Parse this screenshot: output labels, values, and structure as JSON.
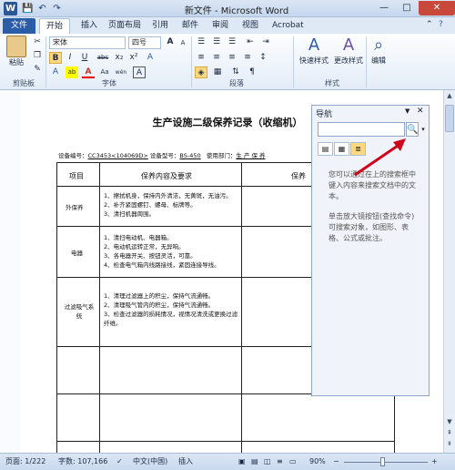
{
  "window": {
    "title": "新文件 - Microsoft Word",
    "minimize": "—",
    "maximize": "□",
    "close": "✕"
  },
  "quick_access": {
    "save": "💾",
    "undo": "↶",
    "redo": "↷"
  },
  "tabs": [
    {
      "label": "文件"
    },
    {
      "label": "开始"
    },
    {
      "label": "插入"
    },
    {
      "label": "页面布局"
    },
    {
      "label": "引用"
    },
    {
      "label": "邮件"
    },
    {
      "label": "审阅"
    },
    {
      "label": "视图"
    },
    {
      "label": "Acrobat"
    }
  ],
  "ribbon": {
    "clipboard": {
      "paste": "粘贴",
      "label": "剪贴板"
    },
    "font": {
      "name": "宋体",
      "size": "四号",
      "label": "字体",
      "grow": "A",
      "shrink": "A",
      "clear": "A",
      "bold": "B",
      "italic": "I",
      "underline": "U",
      "strike": "abc",
      "sub": "x₂",
      "sup": "x²",
      "font_color": "A",
      "highlight": "ab",
      "case": "Aa",
      "phonetic": "wén",
      "charborder": "A"
    },
    "paragraph": {
      "label": "段落"
    },
    "styles": {
      "quick": "快速样式",
      "change": "更改样式",
      "label": "样式"
    },
    "editing": {
      "edit": "编辑"
    }
  },
  "document": {
    "title": "生产设施二级保养记录（收缩机）",
    "info_device_no_label": "设备编号：",
    "info_device_no": "CC3453<104069D>",
    "info_model_label": "设备型号：",
    "info_model": "BS-450",
    "info_dept_label": "使用部门：",
    "info_dept": "生 产 保 养",
    "table": {
      "header": [
        "项目",
        "保养内容及要求",
        "保养"
      ],
      "rows": [
        {
          "item": "外保养",
          "content": [
            "1、擦拭机身，保持内外清洁，无黄斑，无油污。",
            "2、补齐紧固螺钉、螺母、标牌等。",
            "3、清扫机器周围。"
          ]
        },
        {
          "item": "电器",
          "content": [
            "1、清扫电动机、电器箱。",
            "2、电动机运转正常，无异响。",
            "3、各电器开关、按钮灵活，可靠。",
            "4、检查电气箱内线路接线，紧固连接导线。"
          ]
        },
        {
          "item": "过滤吸气系统",
          "content": [
            "1、清理过滤器上的积尘，保持气流通畅。",
            "2、清理吸气管内的积尘，保持气流通畅。",
            "3、检查过滤器的损耗情况，视情况清洗或更换过滤纤维。"
          ]
        }
      ]
    }
  },
  "nav": {
    "title": "导航",
    "close": "✕",
    "pin": "▼",
    "search_placeholder": "",
    "search_btn": "🔍",
    "drop": "▾",
    "hint1": "您可以通过在上的搜索框中键入内容来搜索文档中的文本。",
    "hint2": "单击放大镜按钮(查找命令)可搜索对象，如图形、表格、公式或批注。"
  },
  "status": {
    "page": "页面: 1/222",
    "words": "字数: 107,166",
    "lang": "中文(中国)",
    "insert": "插入",
    "zoom": "90%",
    "minus": "−",
    "plus": "+"
  }
}
